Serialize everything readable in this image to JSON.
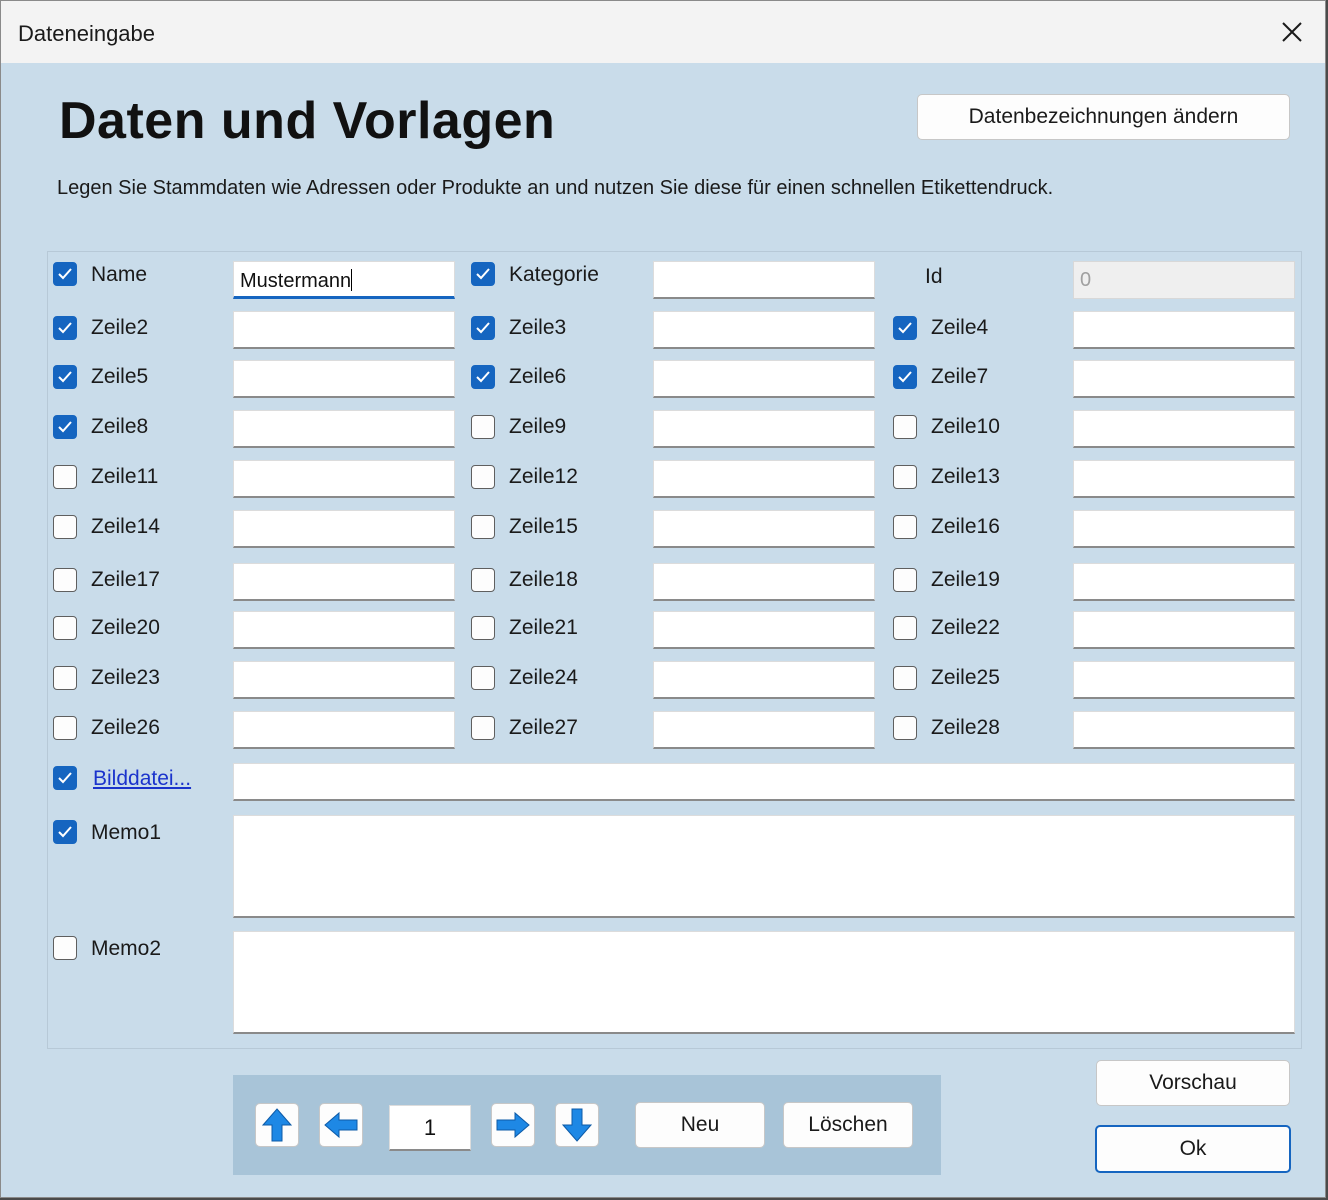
{
  "window": {
    "title": "Dateneingabe"
  },
  "header": {
    "heading": "Daten und Vorlagen",
    "description": "Legen Sie Stammdaten wie Adressen oder Produkte an und nutzen Sie diese für einen schnellen Etikettendruck.",
    "rename_button": "Datenbezeichnungen ändern"
  },
  "fields": {
    "name": {
      "label": "Name",
      "value": "Mustermann",
      "checked": true
    },
    "kategorie": {
      "label": "Kategorie",
      "value": "",
      "checked": true
    },
    "id": {
      "label": "Id",
      "value": "0"
    },
    "rows": [
      {
        "label": "Zeile2",
        "checked": true
      },
      {
        "label": "Zeile3",
        "checked": true
      },
      {
        "label": "Zeile4",
        "checked": true
      },
      {
        "label": "Zeile5",
        "checked": true
      },
      {
        "label": "Zeile6",
        "checked": true
      },
      {
        "label": "Zeile7",
        "checked": true
      },
      {
        "label": "Zeile8",
        "checked": true
      },
      {
        "label": "Zeile9",
        "checked": false
      },
      {
        "label": "Zeile10",
        "checked": false
      },
      {
        "label": "Zeile11",
        "checked": false
      },
      {
        "label": "Zeile12",
        "checked": false
      },
      {
        "label": "Zeile13",
        "checked": false
      },
      {
        "label": "Zeile14",
        "checked": false
      },
      {
        "label": "Zeile15",
        "checked": false
      },
      {
        "label": "Zeile16",
        "checked": false
      },
      {
        "label": "Zeile17",
        "checked": false
      },
      {
        "label": "Zeile18",
        "checked": false
      },
      {
        "label": "Zeile19",
        "checked": false
      },
      {
        "label": "Zeile20",
        "checked": false
      },
      {
        "label": "Zeile21",
        "checked": false
      },
      {
        "label": "Zeile22",
        "checked": false
      },
      {
        "label": "Zeile23",
        "checked": false
      },
      {
        "label": "Zeile24",
        "checked": false
      },
      {
        "label": "Zeile25",
        "checked": false
      },
      {
        "label": "Zeile26",
        "checked": false
      },
      {
        "label": "Zeile27",
        "checked": false
      },
      {
        "label": "Zeile28",
        "checked": false
      }
    ],
    "bilddatei": {
      "label": "Bilddatei...",
      "checked": true,
      "value": ""
    },
    "memo1": {
      "label": "Memo1",
      "checked": true,
      "value": ""
    },
    "memo2": {
      "label": "Memo2",
      "checked": false,
      "value": ""
    }
  },
  "navigation": {
    "page": "1",
    "new_button": "Neu",
    "delete_button": "Löschen",
    "icons": [
      "arrow-up-icon",
      "arrow-left-icon",
      "arrow-right-icon",
      "arrow-down-icon"
    ]
  },
  "actions": {
    "preview_button": "Vorschau",
    "ok_button": "Ok"
  },
  "colors": {
    "accent": "#1565c0",
    "background": "#c9dcea",
    "nav_background": "#a8c4d8",
    "arrow": "#1e88e5"
  }
}
